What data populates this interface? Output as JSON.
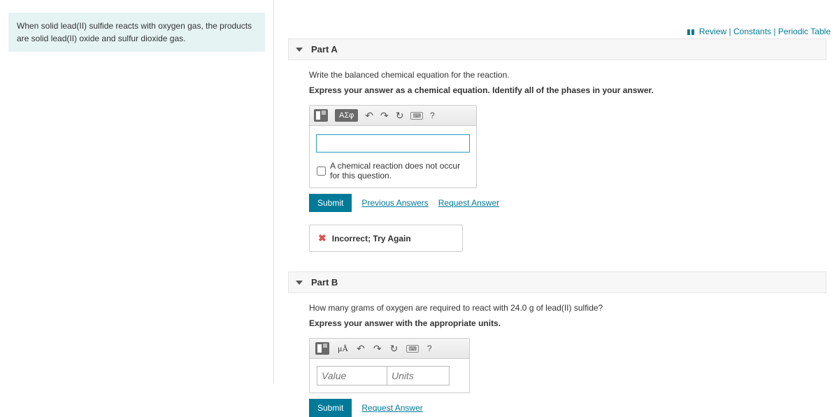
{
  "topLinks": {
    "review": "Review",
    "constants": "Constants",
    "periodic": "Periodic Table"
  },
  "problem": "When solid lead(II) sulfide reacts with oxygen gas, the products are solid lead(II) oxide and sulfur dioxide gas.",
  "partA": {
    "title": "Part A",
    "prompt": "Write the balanced chemical equation for the reaction.",
    "instruct": "Express your answer as a chemical equation. Identify all of the phases in your answer.",
    "greekBtn": "ΑΣφ",
    "checkboxLabel": "A chemical reaction does not occur for this question.",
    "submit": "Submit",
    "prevAnswers": "Previous Answers",
    "reqAnswer": "Request Answer",
    "feedback": "Incorrect; Try Again",
    "help": "?"
  },
  "partB": {
    "title": "Part B",
    "prompt": "How many grams of oxygen are required to react with 24.0 g of lead(II) sulfide?",
    "instruct": "Express your answer with the appropriate units.",
    "muA": "μÅ",
    "valuePlaceholder": "Value",
    "unitsPlaceholder": "Units",
    "submit": "Submit",
    "reqAnswer": "Request Answer",
    "help": "?"
  }
}
